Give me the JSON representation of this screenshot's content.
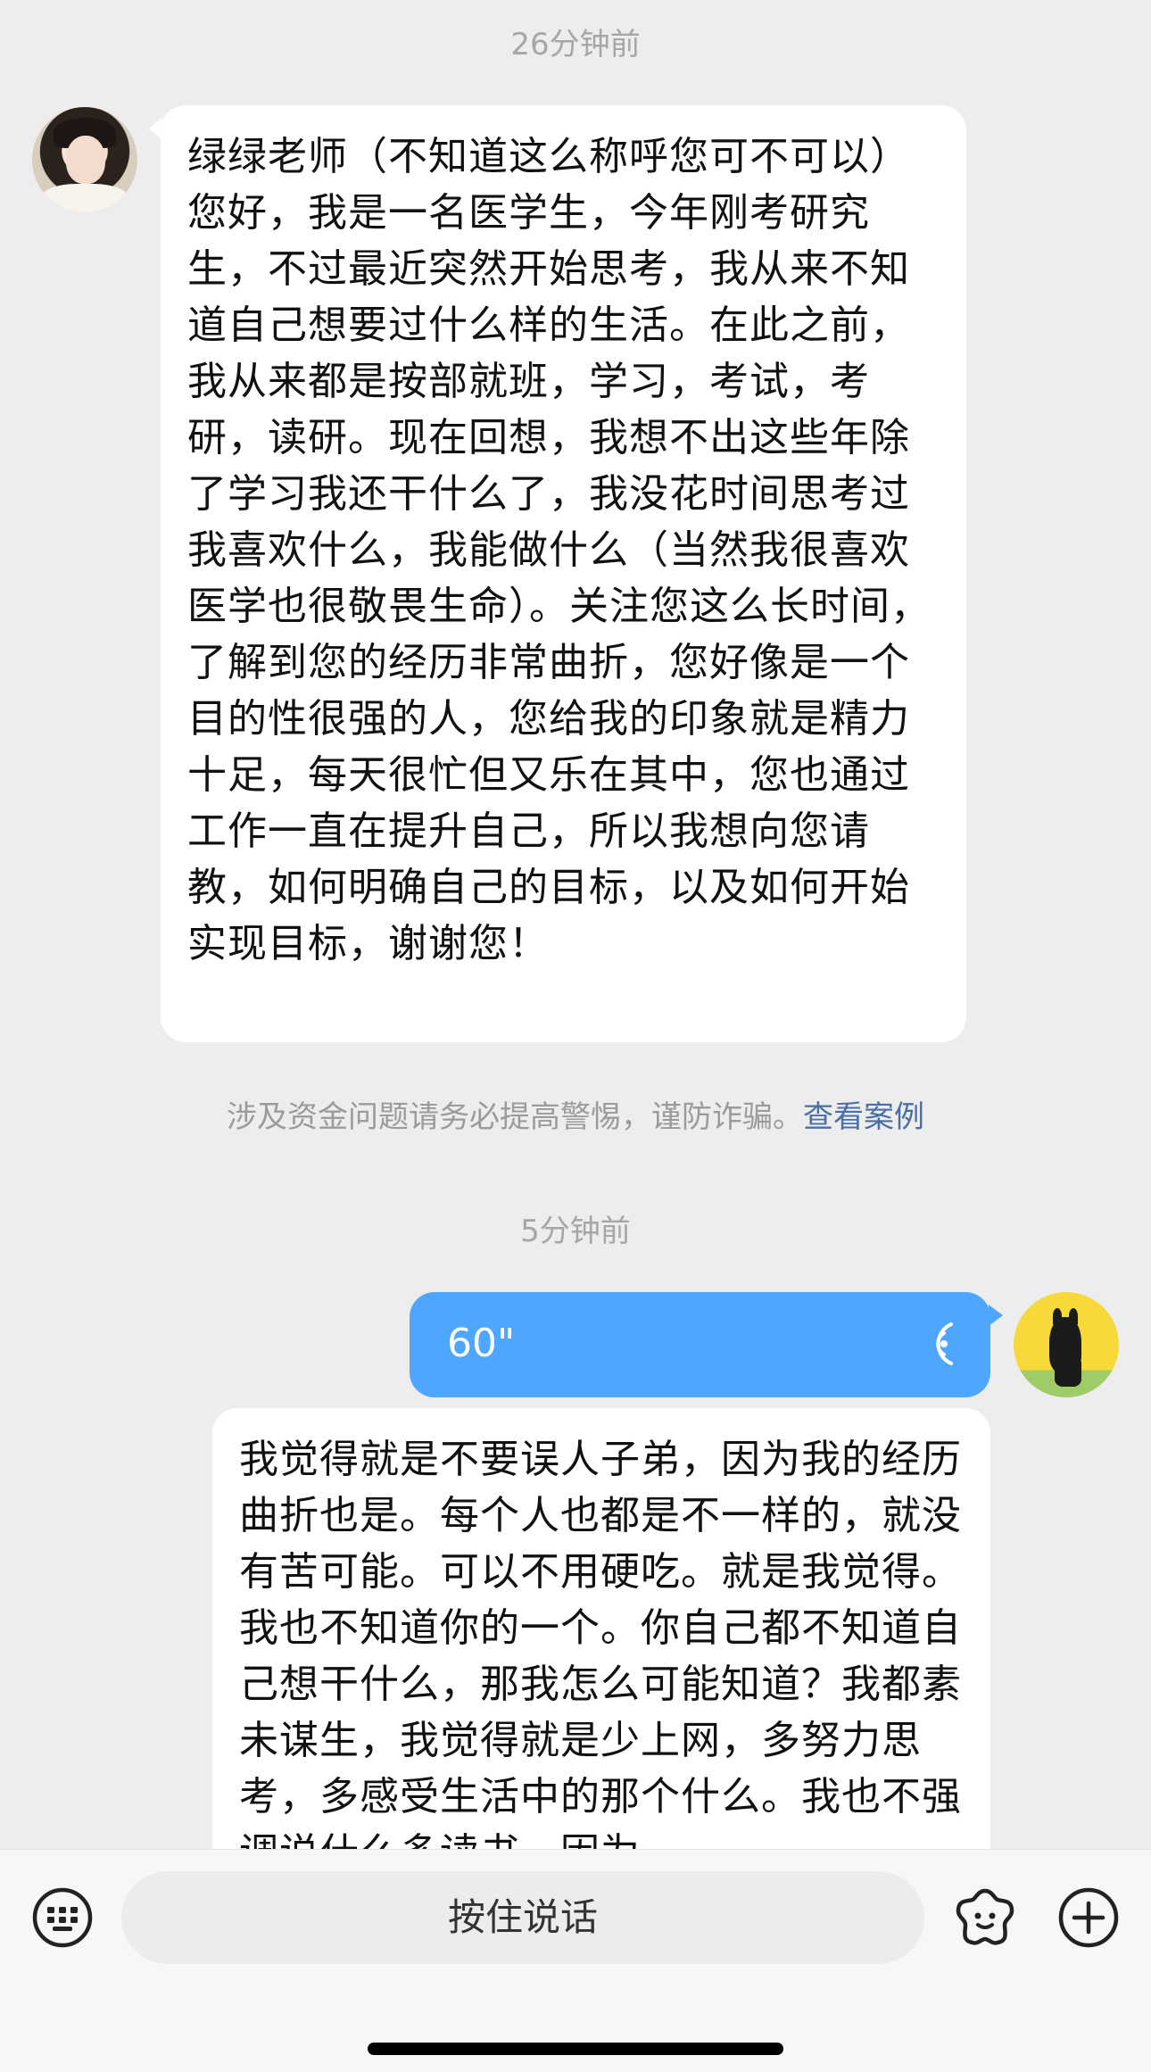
{
  "chat": {
    "timestamp_1": "26分钟前",
    "incoming_message": "绿绿老师（不知道这么称呼您可不可以）您好，我是一名医学生，今年刚考研究生，不过最近突然开始思考，我从来不知道自己想要过什么样的生活。在此之前，我从来都是按部就班，学习，考试，考研，读研。现在回想，我想不出这些年除了学习我还干什么了，我没花时间思考过我喜欢什么，我能做什么（当然我很喜欢医学也很敬畏生命）。关注您这么长时间，了解到您的经历非常曲折，您好像是一个目的性很强的人，您给我的印象就是精力十足，每天很忙但又乐在其中，您也通过工作一直在提升自己，所以我想向您请教，如何明确自己的目标，以及如何开始实现目标，谢谢您！",
    "notice_text": "涉及资金问题请务必提高警惕，谨防诈骗。",
    "notice_link": "查看案例",
    "timestamp_2": "5分钟前",
    "voice_duration": "60\"",
    "outgoing_text": "我觉得就是不要误人子弟，因为我的经历曲折也是。每个人也都是不一样的，就没有苦可能。可以不用硬吃。就是我觉得。我也不知道你的一个。你自己都不知道自己想干什么，那我怎么可能知道？我都素未谋生，我觉得就是少上网，多努力思考，多感受生活中的那个什么。我也不强调说什么多读书，因为"
  },
  "input_bar": {
    "hold_to_talk_label": "按住说话",
    "keyboard_icon": "keyboard-icon",
    "emoji_icon": "emoji-icon",
    "plus_icon": "plus-icon"
  },
  "colors": {
    "background": "#ededed",
    "voice_bubble": "#4ea6ff",
    "link": "#4a6fa5"
  }
}
